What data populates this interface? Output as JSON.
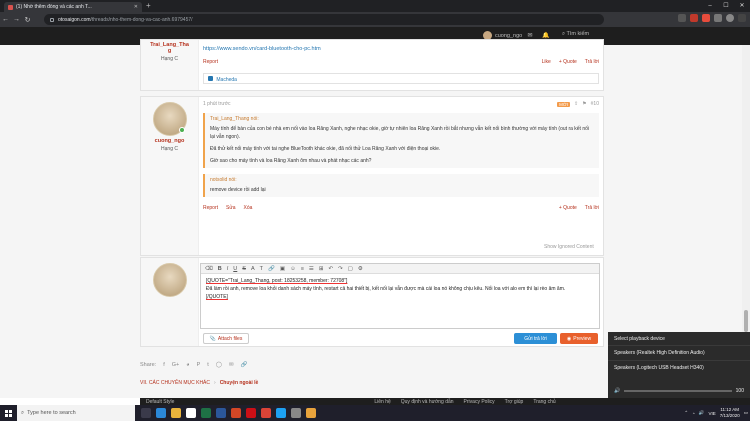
{
  "browser": {
    "tab_title": "(1) Nhờ thêm đồng và các anh T...",
    "url_host": "otosaigon.com",
    "url_path": "/threads/nho-them-dong-va-cac-anh.6979457/"
  },
  "site": {
    "username": "cuong_ngo",
    "search_label": "Tìm kiếm"
  },
  "post1": {
    "username_partial": "Trai_Lang_Tha\ng",
    "rank": "Hạng C",
    "link": "https://www.sendo.vn/card-bluetooth-cho-pc.htm",
    "report": "Report",
    "like": "Like",
    "quote": "+ Quote",
    "reply": "Trả lời",
    "reaction_user": "Macheda"
  },
  "post2": {
    "username": "cuong_ngo",
    "rank": "Hạng C",
    "time": "1 phút trước",
    "badge": "MỚI",
    "post_number": "#10",
    "quote1_author": "Trai_Lang_Thang nói:",
    "quote1_p1": "Máy tính để bàn của con bé nhà em nối vào loa Răng Xanh, nghe nhạc okie, giờ tự nhiên loa Răng Xanh rồi bắt nhưng vẫn kết nối bình thường với máy tính (out ra kết nối lại vẫn ngon).",
    "quote1_p2": "Đã thử kết nối máy tính với tai nghe BlueTooth khác okie, đã nối thử Loa Răng Xanh với điện thoại okie.",
    "quote1_p3": "Giờ sao cho máy tính và loa Răng Xanh ôm nhau và phát nhạc các anh?",
    "quote2_author": "notsolid nói:",
    "quote2_text": "remove device rồi add lại",
    "report": "Report",
    "edit": "Sửa",
    "delete": "Xóa",
    "quote": "+ Quote",
    "reply": "Trả lời",
    "show_ignored": "Show Ignored Content"
  },
  "editor": {
    "line1": "[QUOTE=\"Trai_Lang_Thang, post: 18253258, member: 72708\"]",
    "line2": "Đã làm rồi anh, remove loa khỏi danh sách máy tính, restart cả hai thiết bị, kết nối lại vẫn được mà cái loa nó không chịu kêu. Nối loa với alo em thì lại rèo âm âm.",
    "line3": "[/QUOTE]",
    "attach": "Attach files",
    "submit": "Gửi trả lời",
    "preview": "Preview"
  },
  "share": {
    "label": "Share:"
  },
  "breadcrumb": {
    "parent": "VII. CÁC CHUYÊN MỤC KHÁC",
    "current": "Chuyện ngoài lề"
  },
  "statusbar": {
    "style": "Default Style",
    "links": [
      "Liên hệ",
      "Quy định và hướng dẫn",
      "Privacy Policy",
      "Trợ giúp",
      "Trang chủ"
    ]
  },
  "playback_popup": {
    "title": "Select playback device",
    "devices": [
      "Speakers (Realtek High Definition Audio)",
      "Speakers (Logitech USB Headset H340)"
    ],
    "volume": "100"
  },
  "taskbar": {
    "search_placeholder": "Type here to search",
    "lang": "VIE",
    "time": "11:12 AM",
    "date": "7/13/2020"
  },
  "colors": {
    "accent_red": "#b5301c",
    "link_blue": "#2577b1",
    "quote_orange": "#f0a34b",
    "submit_blue": "#2c8fd6",
    "preview_orange": "#e8602c"
  }
}
